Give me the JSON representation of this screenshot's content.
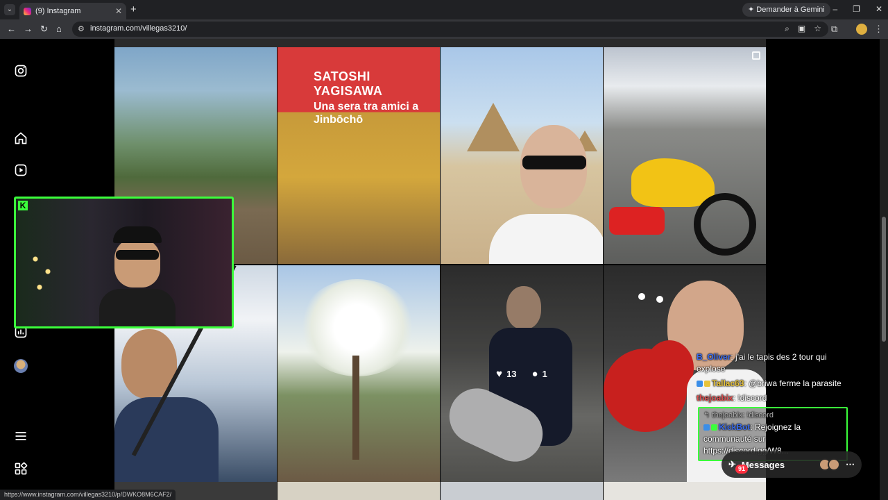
{
  "browser": {
    "tab_title": "(9) Instagram",
    "tab_close": "✕",
    "new_tab": "+",
    "gemini_label": "Demander à Gemini",
    "url": "instagram.com/villegas3210/",
    "status_url": "https://www.instagram.com/villegas3210/p/DWKO8M6CAF2/",
    "window_controls": [
      "–",
      "❐",
      "✕"
    ]
  },
  "sidebar": {
    "icons": [
      "instagram-icon",
      "home-icon",
      "reels-icon",
      "stats-icon",
      "menu-icon",
      "more-apps-icon"
    ]
  },
  "posts": [
    {
      "label": "garden"
    },
    {
      "label": "book",
      "book_title": "SATOSHI YAGISAWA",
      "book_subtitle": "Una sera tra amici a Jinbōchō"
    },
    {
      "label": "pyramids"
    },
    {
      "label": "motorcycle"
    },
    {
      "label": "fishing"
    },
    {
      "label": "blossom-tree"
    },
    {
      "label": "dojo",
      "likes": "13",
      "comments": "1"
    },
    {
      "label": "boxing"
    }
  ],
  "chat": {
    "messages": [
      {
        "user": "B_Oliver",
        "text": ": j'ai le tapis des 2 tour qui explose"
      },
      {
        "user": "Tallac63",
        "text": ": @briwa ferme la parasite"
      },
      {
        "user": "thejoabix",
        "text": ": !discord"
      }
    ],
    "highlight": {
      "reply_to": "thejoabix: !discord",
      "user": "KickBot",
      "text": ": Rejoignez la communauté sur https://discord.gg/W8..."
    }
  },
  "messages_pill": {
    "label": "Messages",
    "count": "91"
  },
  "colors": {
    "accent_green": "#3bff3b",
    "ig_bg": "#000000"
  }
}
